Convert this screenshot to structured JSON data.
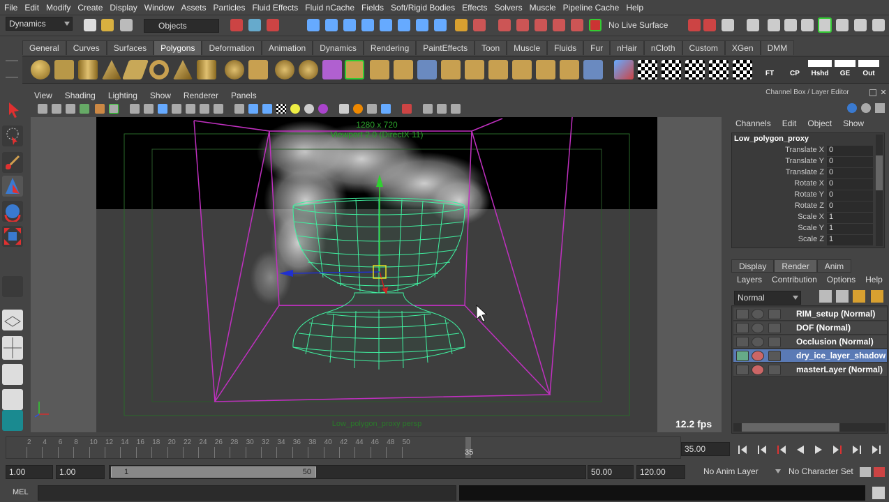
{
  "menubar": [
    "File",
    "Edit",
    "Modify",
    "Create",
    "Display",
    "Window",
    "Assets",
    "Particles",
    "Fluid Effects",
    "Fluid nCache",
    "Fields",
    "Soft/Rigid Bodies",
    "Effects",
    "Solvers",
    "Muscle",
    "Pipeline Cache",
    "Help"
  ],
  "status": {
    "menuset": "Dynamics",
    "selection_mode": "Objects",
    "live_surface": "No Live Surface"
  },
  "shelf_tabs": [
    "General",
    "Curves",
    "Surfaces",
    "Polygons",
    "Deformation",
    "Animation",
    "Dynamics",
    "Rendering",
    "PaintEffects",
    "Toon",
    "Muscle",
    "Fluids",
    "Fur",
    "nHair",
    "nCloth",
    "Custom",
    "XGen",
    "DMM"
  ],
  "shelf_active": "Polygons",
  "shelf_text_buttons": [
    "FT",
    "CP",
    "Hshd",
    "GE",
    "Out"
  ],
  "viewport_menu": [
    "View",
    "Shading",
    "Lighting",
    "Show",
    "Renderer",
    "Panels"
  ],
  "viewport": {
    "resolution": "1280 x 720",
    "renderer": "Viewport 2.0 (DirectX 11)",
    "fps": "12.2 fps",
    "camera_label": "Low_polygon_proxy persp"
  },
  "channel_box": {
    "title": "Channel Box / Layer Editor",
    "menu": [
      "Channels",
      "Edit",
      "Object",
      "Show"
    ],
    "object": "Low_polygon_proxy",
    "channels": [
      {
        "label": "Translate X",
        "value": "0"
      },
      {
        "label": "Translate Y",
        "value": "0"
      },
      {
        "label": "Translate Z",
        "value": "0"
      },
      {
        "label": "Rotate X",
        "value": "0"
      },
      {
        "label": "Rotate Y",
        "value": "0"
      },
      {
        "label": "Rotate Z",
        "value": "0"
      },
      {
        "label": "Scale X",
        "value": "1"
      },
      {
        "label": "Scale Y",
        "value": "1"
      },
      {
        "label": "Scale Z",
        "value": "1"
      }
    ]
  },
  "layer_editor": {
    "tabs": [
      "Display",
      "Render",
      "Anim"
    ],
    "active_tab": "Render",
    "menu": [
      "Layers",
      "Contribution",
      "Options",
      "Help"
    ],
    "mode": "Normal",
    "layers": [
      {
        "name": "RIM_setup (Normal)",
        "selected": false
      },
      {
        "name": "DOF (Normal)",
        "selected": false
      },
      {
        "name": "Occlusion (Normal)",
        "selected": false
      },
      {
        "name": "dry_ice_layer_shadow",
        "selected": true
      },
      {
        "name": "masterLayer (Normal)",
        "selected": false
      }
    ]
  },
  "timeline": {
    "ticks": [
      "2",
      "4",
      "6",
      "8",
      "10",
      "12",
      "14",
      "16",
      "18",
      "20",
      "22",
      "24",
      "26",
      "28",
      "30",
      "32",
      "34",
      "36",
      "38",
      "40",
      "42",
      "44",
      "46",
      "48",
      "50"
    ],
    "current_frame_marker": "35",
    "current_time": "35.00"
  },
  "range": {
    "start": "1.00",
    "playback_start": "1.00",
    "slider_start": "1",
    "slider_end": "50",
    "playback_end": "50.00",
    "end": "120.00",
    "anim_layer": "No Anim Layer",
    "character_set": "No Character Set"
  },
  "command_line": {
    "label": "MEL"
  }
}
